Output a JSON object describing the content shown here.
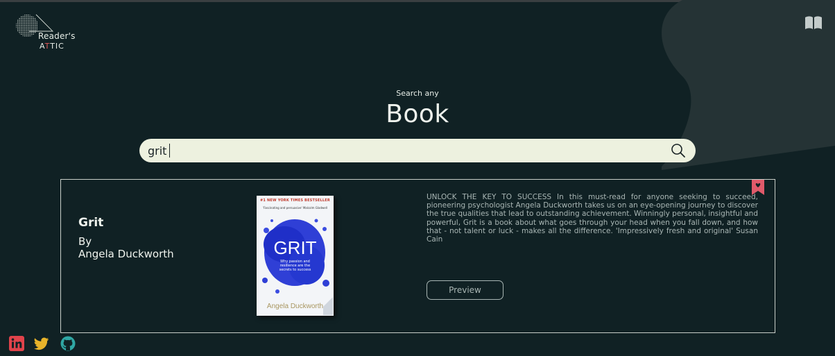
{
  "brand": {
    "line1": "Reader's",
    "line2_prefix": "A",
    "line2_accent": "T",
    "line2_suffix": "TIC",
    "icon": "logo-dotted-globe-icon"
  },
  "header": {
    "right_icon": "open-book-icon"
  },
  "hero": {
    "subtitle": "Search any",
    "title": "Book"
  },
  "search": {
    "value": "grit",
    "placeholder": "",
    "icon": "search-icon"
  },
  "result": {
    "title": "Grit",
    "by_label": "By",
    "author": "Angela Duckworth",
    "description": "UNLOCK THE KEY TO SUCCESS In this must-read for anyone seeking to succeed, pioneering psychologist Angela Duckworth takes us on an eye-opening journey to discover the true qualities that lead to outstanding achievement. Winningly personal, insightful and powerful, Grit is a book about what goes through your head when you fall down, and how that - not talent or luck - makes all the difference. 'Impressively fresh and original' Susan Cain",
    "preview_label": "Preview",
    "bookmark_icon": "bookmark-icon",
    "cover": {
      "top_text": "#1 NEW YORK TIMES BESTSELLER",
      "quote_text": "'Fascinating and persuasive' Malcolm Gladwell",
      "title": "GRIT",
      "tagline": "Why passion and resilience are the secrets to success",
      "author": "Angela Duckworth"
    }
  },
  "social": {
    "items": [
      {
        "name": "linkedin-icon",
        "color": "#e0434b"
      },
      {
        "name": "twitter-icon",
        "color": "#e7b32a"
      },
      {
        "name": "github-icon",
        "color": "#2fa7a4"
      }
    ]
  },
  "colors": {
    "background": "#102124",
    "blob": "#253335",
    "search_bg": "#edf1df",
    "accent_red": "#e05a5a",
    "text_muted": "#a9b6b4"
  }
}
